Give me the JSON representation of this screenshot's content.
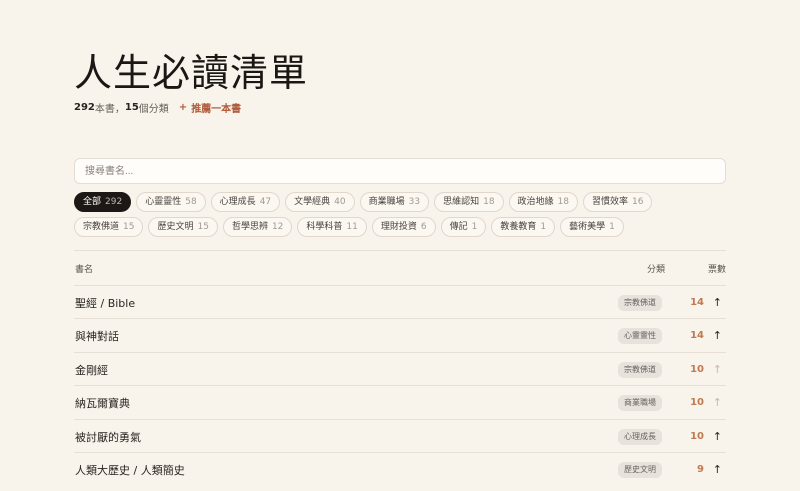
{
  "header": {
    "title": "人生必讀清單",
    "book_count": "292",
    "book_suffix": " 本書，",
    "category_count": "15",
    "category_suffix": " 個分類",
    "recommend_plus": "+",
    "recommend_label": "推薦一本書"
  },
  "search": {
    "placeholder": "搜尋書名..."
  },
  "categories": [
    {
      "label": "全部",
      "count": "292"
    },
    {
      "label": "心靈靈性",
      "count": "58"
    },
    {
      "label": "心理成長",
      "count": "47"
    },
    {
      "label": "文學經典",
      "count": "40"
    },
    {
      "label": "商業職場",
      "count": "33"
    },
    {
      "label": "思維認知",
      "count": "18"
    },
    {
      "label": "政治地緣",
      "count": "18"
    },
    {
      "label": "習慣效率",
      "count": "16"
    },
    {
      "label": "宗教佛道",
      "count": "15"
    },
    {
      "label": "歷史文明",
      "count": "15"
    },
    {
      "label": "哲學思辨",
      "count": "12"
    },
    {
      "label": "科學科普",
      "count": "11"
    },
    {
      "label": "理財投資",
      "count": "6"
    },
    {
      "label": "傳記",
      "count": "1"
    },
    {
      "label": "教養教育",
      "count": "1"
    },
    {
      "label": "藝術美學",
      "count": "1"
    }
  ],
  "table": {
    "headers": {
      "title": "書名",
      "category": "分類",
      "votes": "票數"
    },
    "rows": [
      {
        "title": "聖經 / Bible",
        "category": "宗教佛道",
        "votes": "14",
        "arrow": "↑"
      },
      {
        "title": "與神對話",
        "category": "心靈靈性",
        "votes": "14",
        "arrow": "↑"
      },
      {
        "title": "金剛經",
        "category": "宗教佛道",
        "votes": "10",
        "arrow": "↑"
      },
      {
        "title": "納瓦爾寶典",
        "category": "商業職場",
        "votes": "10",
        "arrow": "↑"
      },
      {
        "title": "被討厭的勇氣",
        "category": "心理成長",
        "votes": "10",
        "arrow": "↑"
      },
      {
        "title": "人類大歷史 / 人類簡史",
        "category": "歷史文明",
        "votes": "9",
        "arrow": "↑"
      }
    ]
  },
  "colors": {
    "accent": "#b05b3b",
    "votes": "#c07a50",
    "background": "#f8f4ec",
    "active_chip": "#1d1815"
  }
}
